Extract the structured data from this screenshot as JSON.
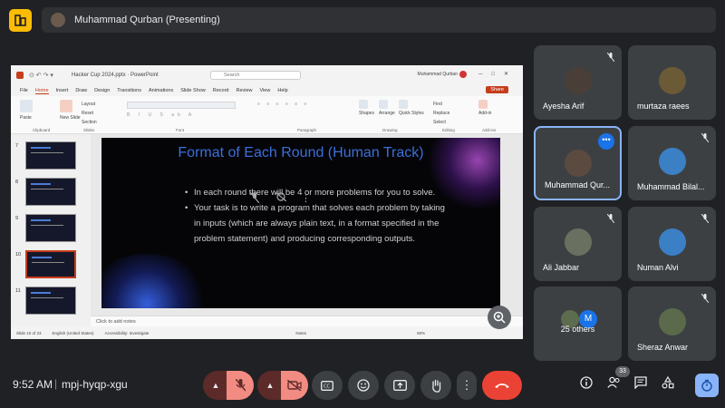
{
  "presenter": {
    "name": "Muhammad Qurban (Presenting)"
  },
  "powerpoint": {
    "filename": "Hacker Cup 2024.pptx  ·  PowerPoint",
    "search_placeholder": "Search",
    "user": "Muhammad Qurban",
    "user_initials": "MQ",
    "menu": [
      "File",
      "Home",
      "Insert",
      "Draw",
      "Design",
      "Transitions",
      "Animations",
      "Slide Show",
      "Record",
      "Review",
      "View",
      "Help"
    ],
    "active_menu": "Home",
    "share_label": "Share",
    "ribbon": {
      "paste": "Paste",
      "new_slide": "New Slide",
      "layout": "Layout",
      "reset": "Reset",
      "section": "Section",
      "shapes": "Shapes",
      "arrange": "Arrange",
      "quick_styles": "Quick Styles",
      "find": "Find",
      "replace": "Replace",
      "select": "Select",
      "addin": "Add-in",
      "groups": [
        "Clipboard",
        "Slides",
        "Font",
        "Paragraph",
        "Drawing",
        "Editing",
        "Add-ins"
      ]
    },
    "thumb_numbers": [
      "7",
      "8",
      "9",
      "10",
      "11"
    ],
    "slide": {
      "title": "Format of Each Round  (Human Track)",
      "bullets": [
        "In each round there will be 4 or more problems for you to solve.",
        "Your task is to write a program that solves each problem by taking in inputs (which are always plain text, in a format specified in the problem statement) and producing corresponding outputs."
      ]
    },
    "notes_placeholder": "Click to add notes",
    "status": {
      "slide_count": "Slide 10 of 23",
      "language": "English (United States)",
      "accessibility": "Accessibility: Investigate",
      "notes": "Notes",
      "zoom": "50%"
    }
  },
  "participants": [
    {
      "name": "Ayesha Arif",
      "muted": true
    },
    {
      "name": "murtaza raees",
      "muted": false
    },
    {
      "name": "Muhammad Qur...",
      "muted": false,
      "active": true
    },
    {
      "name": "Muhammad Bilal...",
      "muted": true
    },
    {
      "name": "Ali Jabbar",
      "muted": true
    },
    {
      "name": "Numan Alvi",
      "muted": true
    },
    {
      "name": "25 others",
      "muted": false
    },
    {
      "name": "Sheraz Anwar",
      "muted": true
    }
  ],
  "others_avatar_letter": "M",
  "bottom": {
    "time": "9:52 AM",
    "separator": "|",
    "meeting_code": "mpj-hyqp-xgu",
    "people_count": "33"
  },
  "colors": {
    "accent": "#8ab4f8",
    "hangup": "#ea4335",
    "mute_red": "#f28b82",
    "tile_bg": "#3c4043"
  },
  "icons": [
    "meet-logo-icon",
    "mic-off-icon",
    "camera-off-icon",
    "captions-icon",
    "emoji-icon",
    "present-icon",
    "raise-hand-icon",
    "more-options-icon",
    "hangup-icon",
    "info-icon",
    "people-icon",
    "chat-icon",
    "activities-icon",
    "timer-icon",
    "zoom-in-icon"
  ]
}
